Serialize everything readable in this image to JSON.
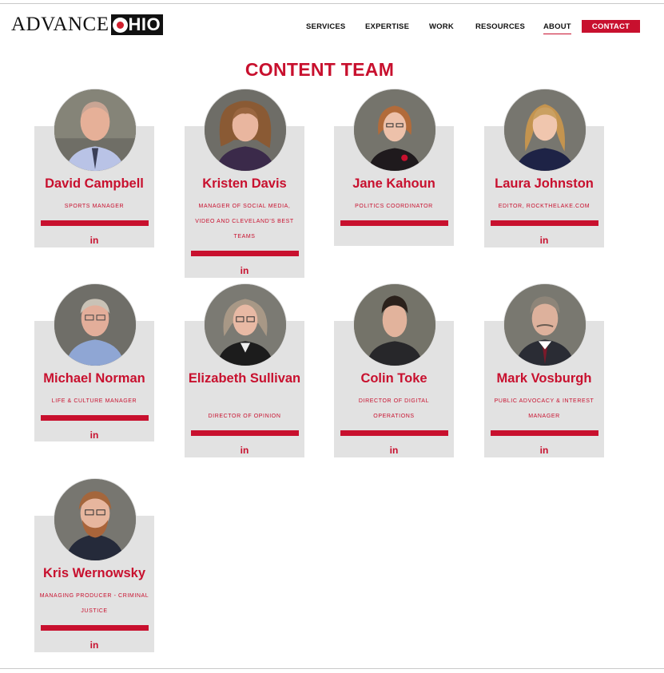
{
  "logo": {
    "advance": "ADVANCE",
    "ohio_rest": "HIO"
  },
  "nav": {
    "items": [
      "SERVICES",
      "EXPERTISE",
      "WORK",
      "RESOURCES",
      "ABOUT"
    ],
    "active": "ABOUT",
    "contact": "CONTACT"
  },
  "colors": {
    "accent": "#c8102e",
    "card_bg": "#e2e2e2"
  },
  "page_title": "CONTENT TEAM",
  "team": [
    {
      "name": "David Campbell",
      "role": "SPORTS MANAGER",
      "social": "in",
      "icon": "linkedin-icon"
    },
    {
      "name": "Kristen Davis",
      "role": "MANAGER OF SOCIAL MEDIA, VIDEO AND CLEVELAND'S BEST TEAMS",
      "social": "in",
      "icon": "linkedin-icon"
    },
    {
      "name": "Jane Kahoun",
      "role": "POLITICS COORDINATOR",
      "social": "",
      "icon": ""
    },
    {
      "name": "Laura Johnston",
      "role": "EDITOR, ROCKTHELAKE.COM",
      "social": "in",
      "icon": "linkedin-icon"
    },
    {
      "name": "Michael Norman",
      "role": "LIFE & CULTURE MANAGER",
      "social": "in",
      "icon": "linkedin-icon"
    },
    {
      "name": "Elizabeth Sullivan",
      "role": "DIRECTOR OF OPINION",
      "social": "in",
      "icon": "linkedin-icon"
    },
    {
      "name": "Colin Toke",
      "role": "DIRECTOR OF DIGITAL OPERATIONS",
      "social": "in",
      "icon": "linkedin-icon"
    },
    {
      "name": "Mark Vosburgh",
      "role": "PUBLIC ADVOCACY & INTEREST MANAGER",
      "social": "in",
      "icon": "linkedin-icon"
    },
    {
      "name": "Kris Wernowsky",
      "role": "MANAGING PRODUCER - CRIMINAL JUSTICE",
      "social": "in",
      "icon": "linkedin-icon"
    }
  ]
}
